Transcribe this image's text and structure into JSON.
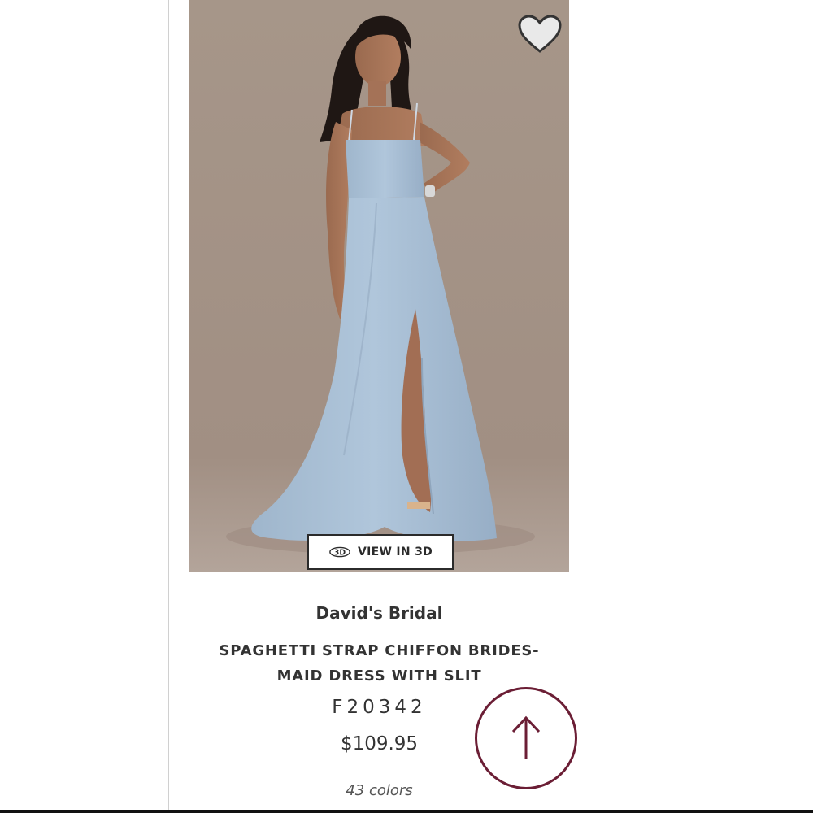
{
  "product": {
    "brand": "David's Bridal",
    "title_line_1": "SPAGHETTI STRAP CHIFFON BRIDES-",
    "title_line_2": "MAID DRESS WITH SLIT",
    "style_number": "F20342",
    "price": "$109.95",
    "colors_count": "43 colors"
  },
  "image": {
    "view_3d_label": "VIEW IN 3D",
    "view_3d_badge": "3D",
    "background_color": "#a49488",
    "dress_color": "#a9c0d6"
  },
  "icons": {
    "wishlist": "heart-icon",
    "view_3d": "rotate-3d-icon",
    "scroll_top": "arrow-up-icon"
  },
  "colors": {
    "accent": "#6b1e35",
    "text": "#333333"
  }
}
